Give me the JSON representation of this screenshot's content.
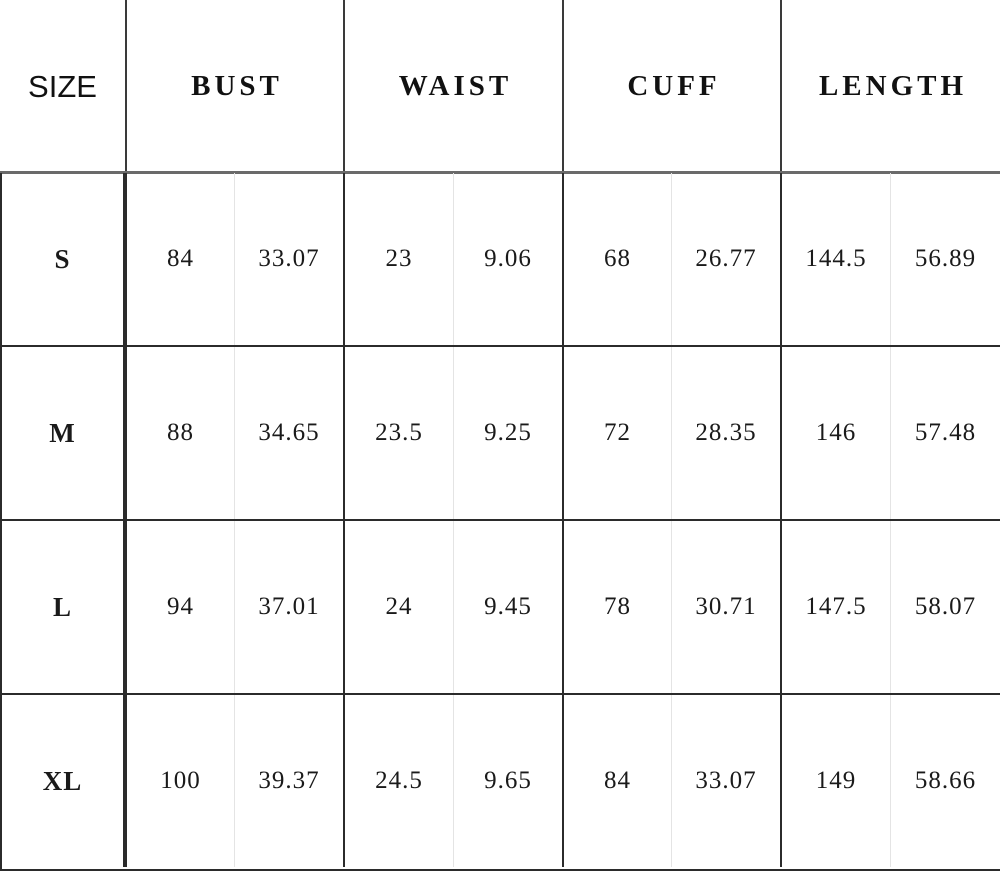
{
  "table": {
    "columns": [
      {
        "key": "size",
        "label": "SIZE",
        "style": "sans"
      },
      {
        "key": "bust",
        "label": "BUST",
        "style": "serif"
      },
      {
        "key": "waist",
        "label": "WAIST",
        "style": "serif"
      },
      {
        "key": "cuff",
        "label": "CUFF",
        "style": "serif"
      },
      {
        "key": "length",
        "label": "LENGTH",
        "style": "serif"
      }
    ],
    "rows": [
      {
        "size": "S",
        "bust_cm": "84",
        "bust_in": "33.07",
        "waist_cm": "23",
        "waist_in": "9.06",
        "cuff_cm": "68",
        "cuff_in": "26.77",
        "length_cm": "144.5",
        "length_in": "56.89"
      },
      {
        "size": "M",
        "bust_cm": "88",
        "bust_in": "34.65",
        "waist_cm": "23.5",
        "waist_in": "9.25",
        "cuff_cm": "72",
        "cuff_in": "28.35",
        "length_cm": "146",
        "length_in": "57.48"
      },
      {
        "size": "L",
        "bust_cm": "94",
        "bust_in": "37.01",
        "waist_cm": "24",
        "waist_in": "9.45",
        "cuff_cm": "78",
        "cuff_in": "30.71",
        "length_cm": "147.5",
        "length_in": "58.07"
      },
      {
        "size": "XL",
        "bust_cm": "100",
        "bust_in": "39.37",
        "waist_cm": "24.5",
        "waist_in": "9.65",
        "cuff_cm": "84",
        "cuff_in": "33.07",
        "length_cm": "149",
        "length_in": "58.66"
      }
    ]
  },
  "colors": {
    "text": "#111111",
    "grid_major": "#2b2b2b",
    "grid_header_rule": "#6a6a6a",
    "grid_minor": "#e4e4e4",
    "background": "#ffffff"
  }
}
